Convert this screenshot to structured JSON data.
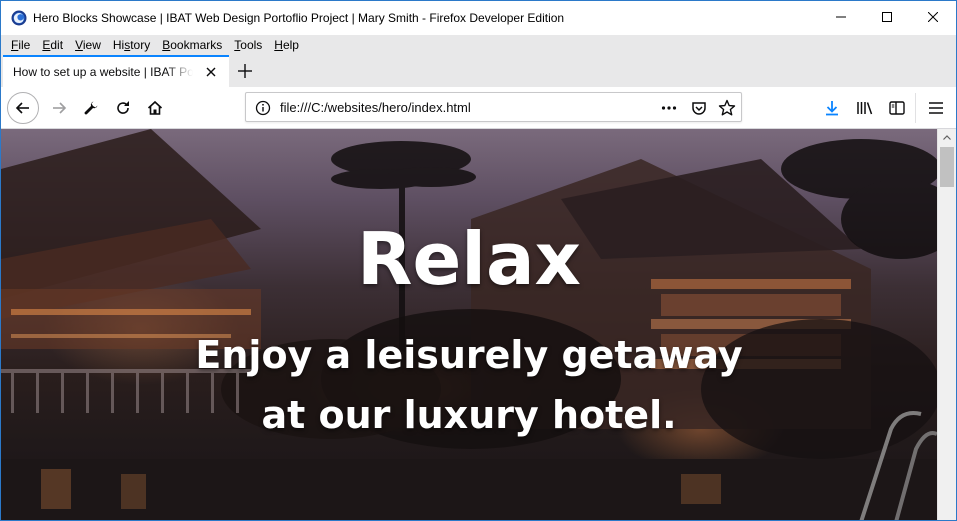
{
  "window": {
    "title": "Hero Blocks Showcase | IBAT Web Design Portoflio Project | Mary Smith - Firefox Developer Edition"
  },
  "menu": [
    {
      "u": "F",
      "rest": "ile"
    },
    {
      "u": "E",
      "rest": "dit"
    },
    {
      "u": "V",
      "rest": "iew"
    },
    {
      "u": "",
      "pre": "Hi",
      "us": "s",
      "post": "tory"
    },
    {
      "u": "B",
      "rest": "ookmarks"
    },
    {
      "u": "T",
      "rest": "ools"
    },
    {
      "u": "H",
      "rest": "elp"
    }
  ],
  "menu_labels": {
    "file_u": "F",
    "file_rest": "ile",
    "edit_u": "E",
    "edit_rest": "dit",
    "view_u": "V",
    "view_rest": "iew",
    "history_pre": "Hi",
    "history_u": "s",
    "history_rest": "tory",
    "bookmarks_u": "B",
    "bookmarks_rest": "ookmarks",
    "tools_u": "T",
    "tools_rest": "ools",
    "help_u": "H",
    "help_rest": "elp"
  },
  "tab": {
    "label": "How to set up a website | IBAT Portfolio"
  },
  "url": {
    "value": "file:///C:/websites/hero/index.html"
  },
  "hero": {
    "title": "Relax",
    "subtitle": "Enjoy a leisurely getaway at our luxury hotel."
  },
  "colors": {
    "accent": "#0a84ff",
    "download_icon": "#0a84ff"
  },
  "icons": [
    "firefox-icon",
    "minimize-icon",
    "maximize-icon",
    "close-icon",
    "tab-close-icon",
    "new-tab-icon",
    "back-icon",
    "forward-icon",
    "wrench-icon",
    "reload-icon",
    "home-icon",
    "info-icon",
    "more-icon",
    "pocket-icon",
    "bookmark-star-icon",
    "download-icon",
    "library-icon",
    "sidebar-icon",
    "hamburger-menu-icon",
    "scroll-up-icon"
  ]
}
